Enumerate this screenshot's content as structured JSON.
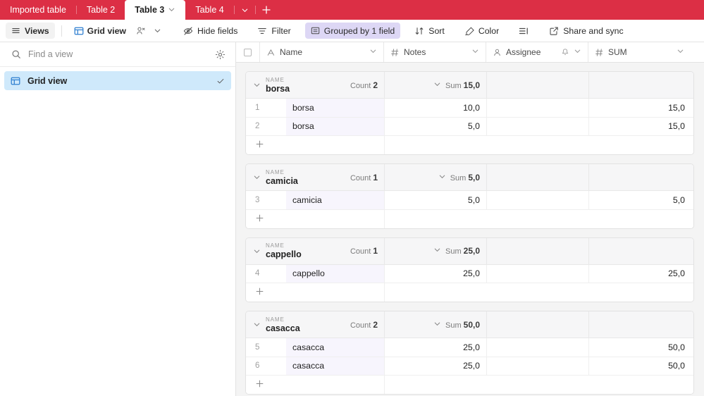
{
  "tabbar": {
    "tabs": [
      {
        "label": "Imported table",
        "active": false,
        "chevron": false
      },
      {
        "label": "Table 2",
        "active": false,
        "chevron": false
      },
      {
        "label": "Table 3",
        "active": true,
        "chevron": true
      },
      {
        "label": "Table 4",
        "active": false,
        "chevron": false
      }
    ],
    "overflow_chevron": "⌄",
    "add_tab_label": "+",
    "background_color": "#dc2f45"
  },
  "toolbar": {
    "views_label": "Views",
    "grid_view_label": "Grid view",
    "hide_fields_label": "Hide fields",
    "filter_label": "Filter",
    "grouped_label": "Grouped by 1 field",
    "grouped_color": "#ddd7f5",
    "sort_label": "Sort",
    "color_label": "Color",
    "row_height_label": "",
    "share_label": "Share and sync"
  },
  "sidebar": {
    "search_placeholder": "Find a view",
    "search_value": "",
    "settings_icon": "gear-icon",
    "views": [
      {
        "label": "Grid view",
        "selected": true,
        "icon": "grid-icon",
        "check": "✓"
      }
    ],
    "selected_color": "#cfe9fb"
  },
  "columns": [
    {
      "name": "Name",
      "type_icon": "text-icon",
      "chevron": "⌄"
    },
    {
      "name": "Notes",
      "type_icon": "number-icon",
      "chevron": "⌄"
    },
    {
      "name": "Assignee",
      "type_icon": "person-icon",
      "chevron": "⌄",
      "bell": "bell-icon"
    },
    {
      "name": "SUM",
      "type_icon": "number-icon",
      "chevron": "⌄"
    }
  ],
  "group_field_label": "NAME",
  "count_label": "Count",
  "sum_label": "Sum",
  "add_row_glyph": "+",
  "groups": [
    {
      "value": "borsa",
      "count": "2",
      "notes_sum": "15,0",
      "sum_sum": "",
      "rows": [
        {
          "num": "1",
          "name": "borsa",
          "notes": "10,0",
          "assignee": "",
          "sum": "15,0"
        },
        {
          "num": "2",
          "name": "borsa",
          "notes": "5,0",
          "assignee": "",
          "sum": "15,0"
        }
      ]
    },
    {
      "value": "camicia",
      "count": "1",
      "notes_sum": "5,0",
      "sum_sum": "",
      "rows": [
        {
          "num": "3",
          "name": "camicia",
          "notes": "5,0",
          "assignee": "",
          "sum": "5,0"
        }
      ]
    },
    {
      "value": "cappello",
      "count": "1",
      "notes_sum": "25,0",
      "sum_sum": "",
      "rows": [
        {
          "num": "4",
          "name": "cappello",
          "notes": "25,0",
          "assignee": "",
          "sum": "25,0"
        }
      ]
    },
    {
      "value": "casacca",
      "count": "2",
      "notes_sum": "50,0",
      "sum_sum": "",
      "rows": [
        {
          "num": "5",
          "name": "casacca",
          "notes": "25,0",
          "assignee": "",
          "sum": "50,0"
        },
        {
          "num": "6",
          "name": "casacca",
          "notes": "25,0",
          "assignee": "",
          "sum": "50,0"
        }
      ]
    }
  ]
}
